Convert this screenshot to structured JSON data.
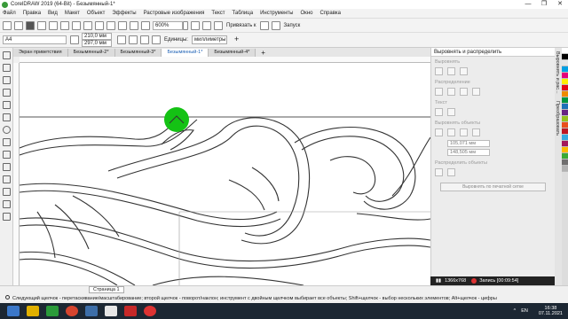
{
  "window": {
    "title": "CorelDRAW 2019 (64-Bit) - Безымянный-1*",
    "controls": [
      "—",
      "❐",
      "✕"
    ]
  },
  "menu": [
    "Файл",
    "Правка",
    "Вид",
    "Макет",
    "Объект",
    "Эффекты",
    "Растровые изображения",
    "Текст",
    "Таблица",
    "Инструменты",
    "Окно",
    "Справка"
  ],
  "standard_toolbar": {
    "zoom": "600%",
    "snap_label": "Привязать к",
    "launch_label": "Запуск"
  },
  "property_bar": {
    "page_size": "A4",
    "width": "210,0 мм",
    "height": "297,0 мм",
    "units_label": "Единицы:",
    "units_value": "миллиметры"
  },
  "doc_tabs": [
    {
      "label": "Экран приветствия",
      "active": false
    },
    {
      "label": "Безымянный-2*",
      "active": false
    },
    {
      "label": "Безымянный-3*",
      "active": false
    },
    {
      "label": "Безымянный-1*",
      "active": true
    },
    {
      "label": "Безымянный-4*",
      "active": false
    }
  ],
  "docker": {
    "title": "Выровнять и распределить",
    "sections": {
      "align": "Выровнять",
      "distribute": "Распределение",
      "text": "Текст",
      "align_objects": "Выровнять объекты",
      "distribute_objects": "Распределить объекты"
    },
    "x_value": "105,071 мм",
    "y_value": "148,505 мм",
    "button": "Выровнять по печатной сетке"
  },
  "side_tabs": [
    "Выровнять и рас...",
    "Преобразовать"
  ],
  "recording": {
    "resolution": "1366x768",
    "label": "Запись [00:09:54]"
  },
  "status": {
    "page_tab": "Страница 1",
    "hint": "Следующий щелчок - перетаскивание/масштабирование; второй щелчок - поворот/наклон; инструмент с двойным щелчком выбирает все объекты; Shift+щелчок - выбор нескольких элементов; Alt+щелчок - цифры"
  },
  "taskbar": {
    "lang": "EN",
    "time": "16:38",
    "date": "07.11.2021"
  },
  "colors": {
    "selection_marker": "#14c214",
    "active_tab_text": "#1a5fb4",
    "taskbar": "#1c2733"
  }
}
